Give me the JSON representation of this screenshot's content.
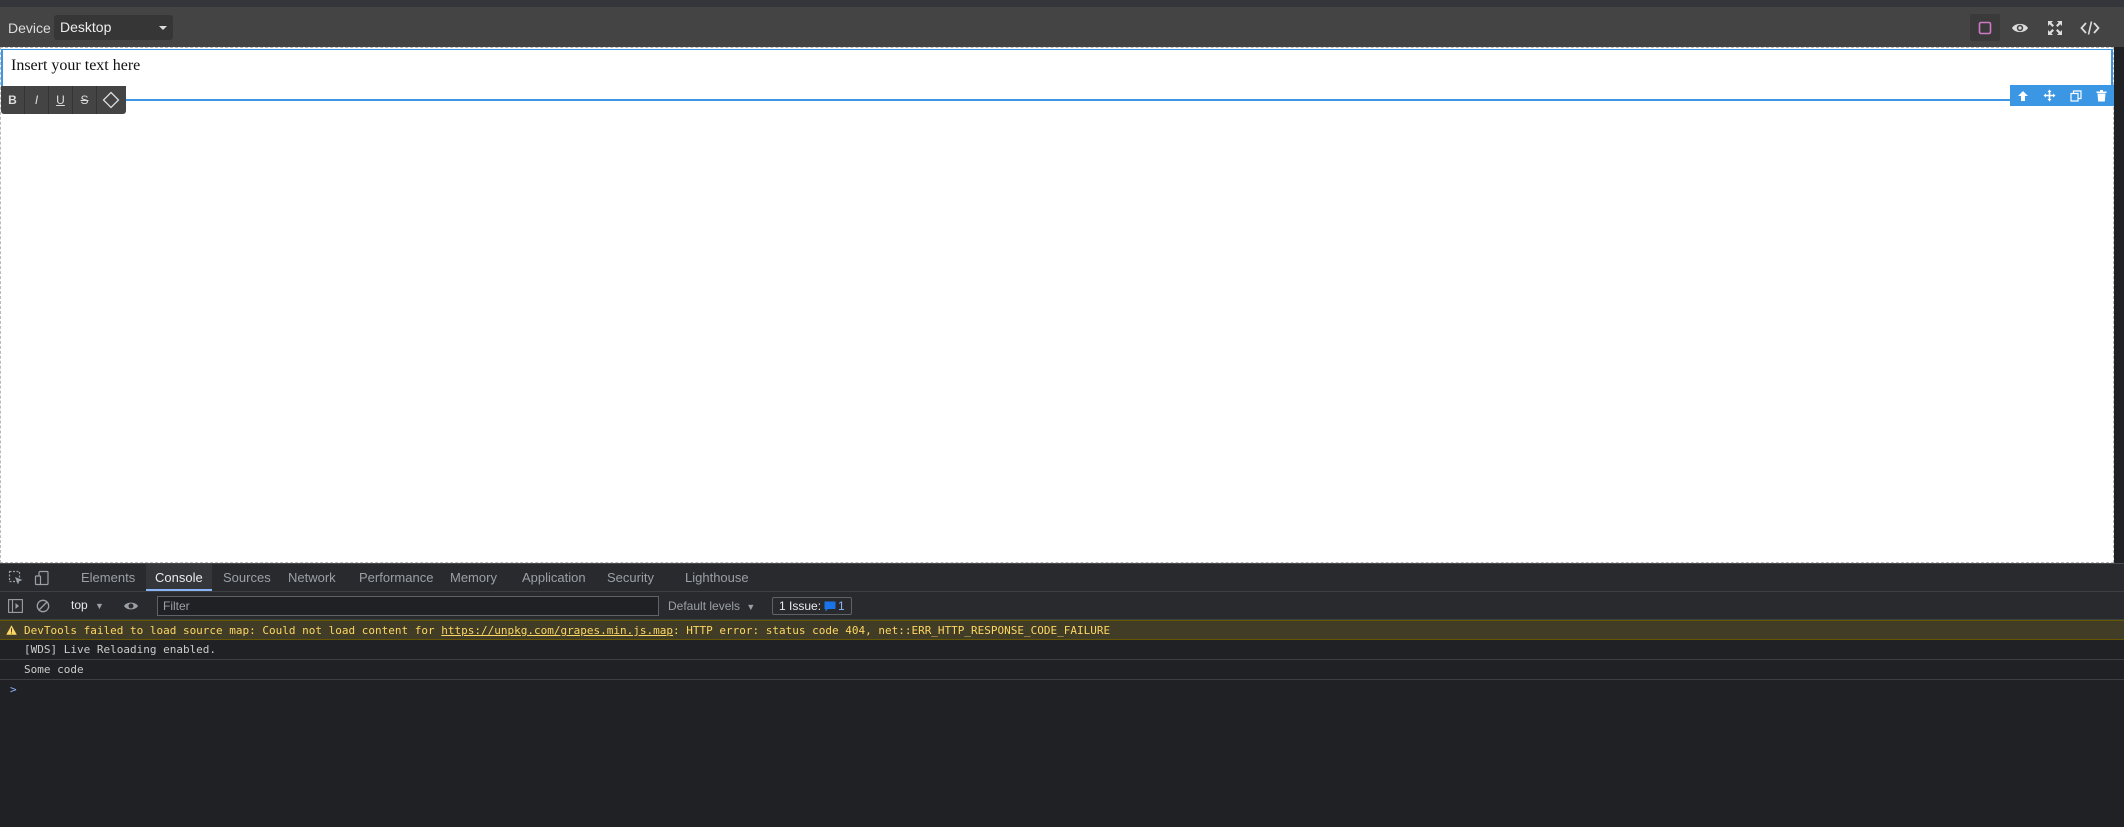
{
  "editor": {
    "device_label": "Device",
    "device_value": "Desktop",
    "panel_buttons": [
      "sw-visibility",
      "preview",
      "fullscreen",
      "export-template"
    ],
    "text_content": "Insert your text here",
    "rte": {
      "bold": "B",
      "italic": "I",
      "underline": "U",
      "strikethrough": "S"
    },
    "component_toolbar": [
      "arrow-up-icon",
      "move-icon",
      "clone-icon",
      "delete-icon"
    ],
    "accent_color": "#3b97e3"
  },
  "devtools": {
    "tabs": [
      "Elements",
      "Console",
      "Sources",
      "Network",
      "Performance",
      "Memory",
      "Application",
      "Security",
      "Lighthouse"
    ],
    "active_tab": "Console",
    "toolbar": {
      "context": "top",
      "filter_placeholder": "Filter",
      "levels": "Default levels",
      "issues_label": "1 Issue:",
      "issues_count": "1"
    },
    "messages": {
      "warning_prefix": "DevTools failed to load source map: Could not load content for ",
      "warning_link": "https://unpkg.com/grapes.min.js.map",
      "warning_suffix": ": HTTP error: status code 404, net::ERR_HTTP_RESPONSE_CODE_FAILURE",
      "log1": "[WDS] Live Reloading enabled.",
      "log2": "Some code"
    },
    "prompt_symbol": ">"
  }
}
